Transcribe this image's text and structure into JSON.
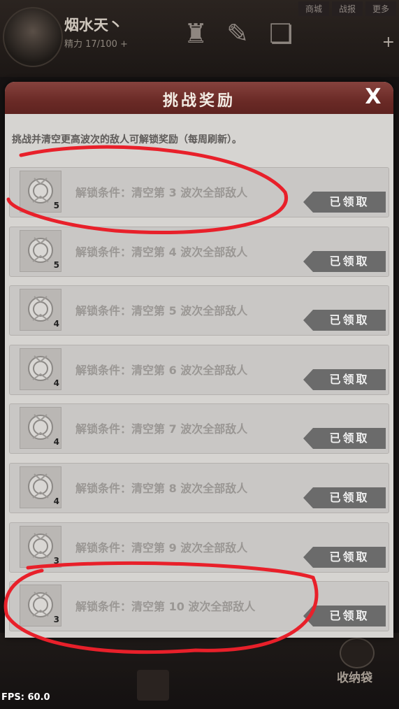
{
  "player": {
    "name": "烟水天丶",
    "stamina": "精力 17/100 +"
  },
  "top_links": [
    "商城",
    "战报",
    "更多"
  ],
  "modal": {
    "title": "挑战奖励",
    "close": "X",
    "intro": "挑战并清空更高波次的敌人可解锁奖励（每周刷新）。",
    "rows": [
      {
        "count": "5",
        "condition": "解锁条件：清空第 3 波次全部敌人",
        "button": "已领取"
      },
      {
        "count": "5",
        "condition": "解锁条件：清空第 4 波次全部敌人",
        "button": "已领取"
      },
      {
        "count": "4",
        "condition": "解锁条件：清空第 5 波次全部敌人",
        "button": "已领取"
      },
      {
        "count": "4",
        "condition": "解锁条件：清空第 6 波次全部敌人",
        "button": "已领取"
      },
      {
        "count": "4",
        "condition": "解锁条件：清空第 7 波次全部敌人",
        "button": "已领取"
      },
      {
        "count": "4",
        "condition": "解锁条件：清空第 8 波次全部敌人",
        "button": "已领取"
      },
      {
        "count": "3",
        "condition": "解锁条件：清空第 9 波次全部敌人",
        "button": "已领取"
      },
      {
        "count": "3",
        "condition": "解锁条件：清空第 10 波次全部敌人",
        "button": "已领取"
      }
    ]
  },
  "bottom": {
    "collect_label": "收纳袋",
    "fps": "FPS: 60.0"
  },
  "colors": {
    "header": "#6a2a26",
    "annotation": "#e8202a",
    "claimed_button": "#6b6b6b"
  }
}
